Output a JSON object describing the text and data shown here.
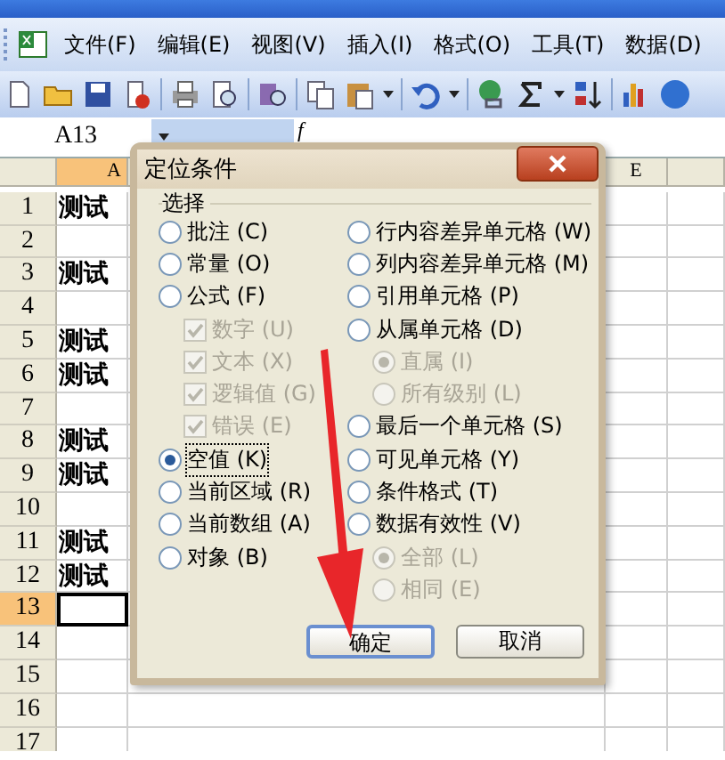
{
  "menu_bar": {
    "items": [
      "文件(F)",
      "编辑(E)",
      "视图(V)",
      "插入(I)",
      "格式(O)",
      "工具(T)",
      "数据(D)"
    ]
  },
  "formula_bar": {
    "name_box": "A13",
    "function_label": "f"
  },
  "sheet": {
    "columns": [
      {
        "label": "A",
        "selected": true
      },
      {
        "label": "E",
        "selected": false
      }
    ],
    "rows": [
      {
        "header": "1",
        "cell_a": "测试",
        "selected": false
      },
      {
        "header": "2",
        "selected": false
      },
      {
        "header": "3",
        "cell_a": "测试",
        "selected": false
      },
      {
        "header": "4",
        "selected": false
      },
      {
        "header": "5",
        "cell_a": "测试",
        "selected": false
      },
      {
        "header": "6",
        "cell_a": "测试",
        "selected": false
      },
      {
        "header": "7",
        "selected": false
      },
      {
        "header": "8",
        "cell_a": "测试",
        "selected": false
      },
      {
        "header": "9",
        "cell_a": "测试",
        "selected": false
      },
      {
        "header": "10",
        "selected": false
      },
      {
        "header": "11",
        "cell_a": "测试",
        "selected": false
      },
      {
        "header": "12",
        "cell_a": "测试",
        "selected": false
      },
      {
        "header": "13",
        "selected": true
      },
      {
        "header": "14",
        "selected": false
      },
      {
        "header": "15",
        "selected": false
      },
      {
        "header": "16",
        "selected": false
      },
      {
        "header": "17",
        "selected": false
      }
    ]
  },
  "dialog": {
    "title": "定位条件",
    "group_label": "选择",
    "left_options": [
      {
        "kind": "radio",
        "label": "批注 (C)",
        "selected": false,
        "disabled": false
      },
      {
        "kind": "radio",
        "label": "常量 (O)",
        "selected": false,
        "disabled": false
      },
      {
        "kind": "radio",
        "label": "公式 (F)",
        "selected": false,
        "disabled": false,
        "children": [
          {
            "kind": "checkbox",
            "label": "数字 (U)",
            "checked": true,
            "disabled": true
          },
          {
            "kind": "checkbox",
            "label": "文本 (X)",
            "checked": true,
            "disabled": true
          },
          {
            "kind": "checkbox",
            "label": "逻辑值 (G)",
            "checked": true,
            "disabled": true
          },
          {
            "kind": "checkbox",
            "label": "错误 (E)",
            "checked": true,
            "disabled": true
          }
        ]
      },
      {
        "kind": "radio",
        "label": "空值 (K)",
        "selected": true,
        "disabled": false
      },
      {
        "kind": "radio",
        "label": "当前区域 (R)",
        "selected": false,
        "disabled": false
      },
      {
        "kind": "radio",
        "label": "当前数组 (A)",
        "selected": false,
        "disabled": false
      },
      {
        "kind": "radio",
        "label": "对象 (B)",
        "selected": false,
        "disabled": false
      }
    ],
    "right_options": [
      {
        "kind": "radio",
        "label": "行内容差异单元格 (W)",
        "selected": false,
        "disabled": false
      },
      {
        "kind": "radio",
        "label": "列内容差异单元格 (M)",
        "selected": false,
        "disabled": false
      },
      {
        "kind": "radio",
        "label": "引用单元格 (P)",
        "selected": false,
        "disabled": false
      },
      {
        "kind": "radio",
        "label": "从属单元格 (D)",
        "selected": false,
        "disabled": false,
        "children": [
          {
            "kind": "radio",
            "label": "直属 (I)",
            "selected": true,
            "disabled": true
          },
          {
            "kind": "radio",
            "label": "所有级别 (L)",
            "selected": false,
            "disabled": true
          }
        ]
      },
      {
        "kind": "radio",
        "label": "最后一个单元格 (S)",
        "selected": false,
        "disabled": false
      },
      {
        "kind": "radio",
        "label": "可见单元格 (Y)",
        "selected": false,
        "disabled": false
      },
      {
        "kind": "radio",
        "label": "条件格式 (T)",
        "selected": false,
        "disabled": false
      },
      {
        "kind": "radio",
        "label": "数据有效性 (V)",
        "selected": false,
        "disabled": false,
        "children": [
          {
            "kind": "radio",
            "label": "全部 (L)",
            "selected": true,
            "disabled": true
          },
          {
            "kind": "radio",
            "label": "相同 (E)",
            "selected": false,
            "disabled": true
          }
        ]
      }
    ],
    "buttons": [
      {
        "label": "确定",
        "default": true
      },
      {
        "label": "取消",
        "default": false
      }
    ]
  }
}
